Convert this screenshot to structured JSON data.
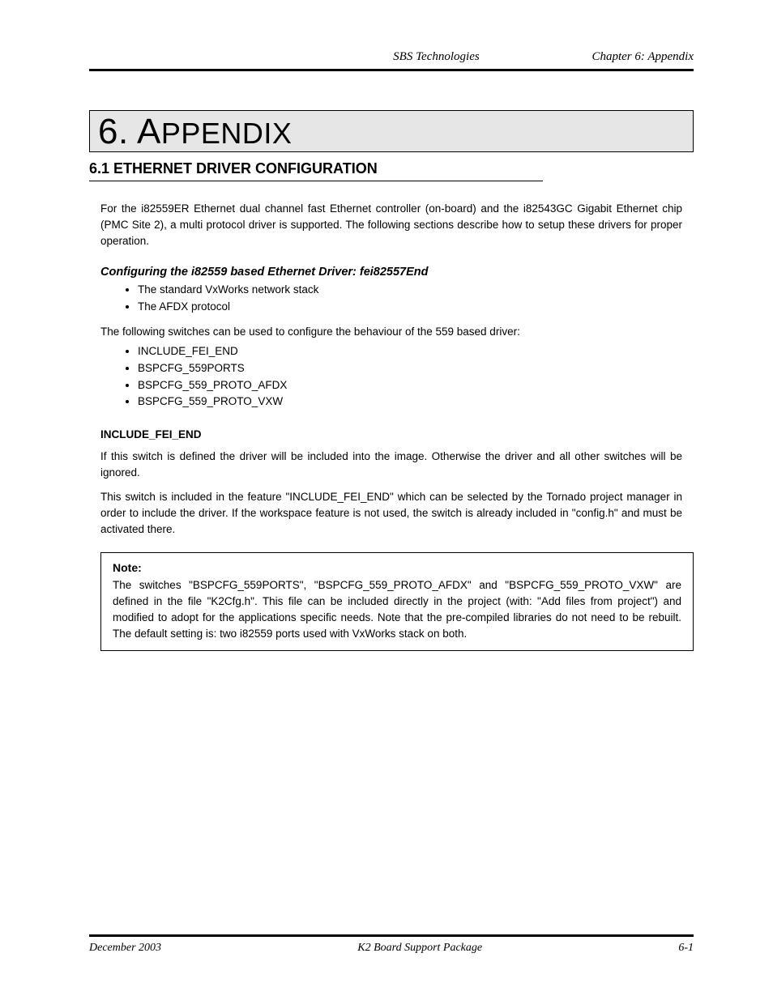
{
  "header": {
    "product": "SBS Technologies",
    "chapter_label": "Chapter 6: Appendix"
  },
  "chapter": {
    "number": "6.",
    "title_first": "A",
    "title_rest": "PPENDIX"
  },
  "section1": {
    "heading": "6.1 ETHERNET DRIVER CONFIGURATION",
    "intro": "For the i82559ER Ethernet dual channel fast Ethernet controller (on-board) and the i82543GC Gigabit Ethernet chip (PMC Site 2), a multi protocol driver is supported. The following sections describe how to setup these drivers for proper operation.",
    "sub_label": "Configuring the i82559 based Ethernet Driver: fei82557End",
    "bullets1": [
      "The standard VxWorks network stack",
      "The AFDX protocol"
    ],
    "bullets_intro2": "The following switches can be used to configure the behaviour of the 559 based driver:",
    "bullets2": [
      "INCLUDE_FEI_END",
      "BSPCFG_559PORTS",
      "BSPCFG_559_PROTO_AFDX",
      "BSPCFG_559_PROTO_VXW"
    ],
    "switch1": {
      "name": "INCLUDE_FEI_END",
      "body1": "If this switch is defined the driver will be included into the image. Otherwise the driver and all other switches will be ignored.",
      "body2": "This switch is included in the feature \"INCLUDE_FEI_END\" which can be selected by the Tornado project manager in order to include the driver. If the workspace feature is not used, the switch is already included in \"config.h\" and must be activated there."
    },
    "note": {
      "title": "Note:",
      "body": "The switches \"BSPCFG_559PORTS\", \"BSPCFG_559_PROTO_AFDX\" and \"BSPCFG_559_PROTO_VXW\" are defined in the file \"K2Cfg.h\". This file can be included directly in the project (with: \"Add files from project\") and modified to adopt for the applications specific needs. Note that the pre-compiled libraries do not need to be rebuilt. The default setting is: two i82559 ports used with VxWorks stack on both."
    }
  },
  "footer": {
    "left": "December 2003",
    "center": "K2 Board Support Package",
    "right": "6-1"
  }
}
